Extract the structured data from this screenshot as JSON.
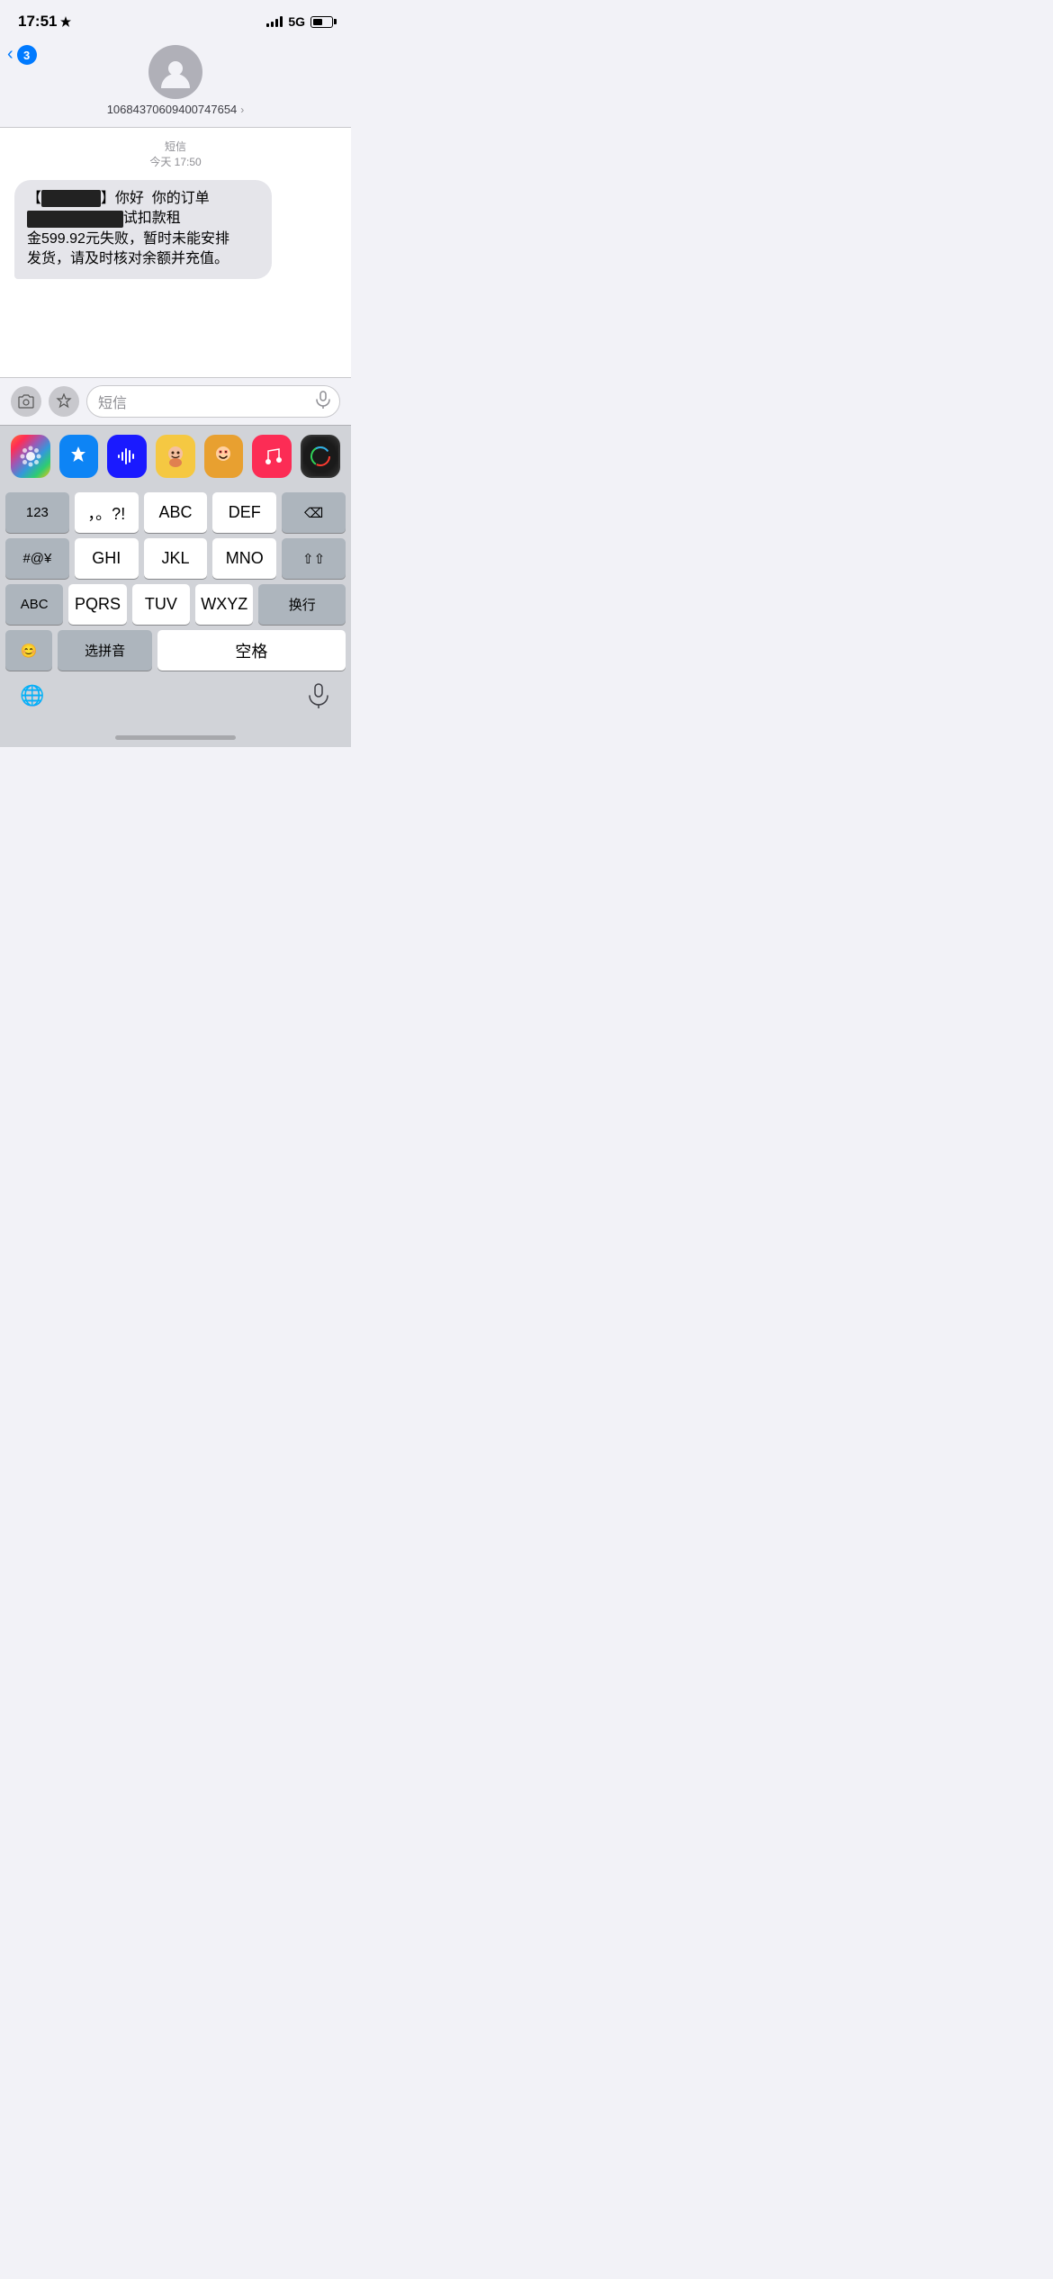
{
  "statusBar": {
    "time": "17:51",
    "network": "5G"
  },
  "navigation": {
    "backLabel": "3",
    "contactNumber": "10684370609400747654",
    "chevron": ">"
  },
  "message": {
    "dateLabel": "短信",
    "timeLabel": "今天 17:50",
    "bubbleText": "【人人租】你好  你的订单\n试扣款租金599.92元失败，暂时未能安排发货，请及时核对余额并充值。"
  },
  "inputArea": {
    "placeholder": "短信"
  },
  "keyboard": {
    "row1": [
      "123",
      "，。?!",
      "ABC",
      "DEF"
    ],
    "row2": [
      "#@¥",
      "GHI",
      "JKL",
      "MNO"
    ],
    "row3": [
      "ABC",
      "PQRS",
      "TUV",
      "WXYZ"
    ],
    "bottomLeft": "😊",
    "bottomMid1": "选拼音",
    "bottomMid2": "空格",
    "bottomRight": "换行",
    "deleteKey": "⌫",
    "shiftKey": "⇧"
  },
  "shortcuts": {
    "icons": [
      "photos",
      "appstore",
      "voice",
      "memoji",
      "memoji2",
      "music",
      "fitness"
    ]
  }
}
